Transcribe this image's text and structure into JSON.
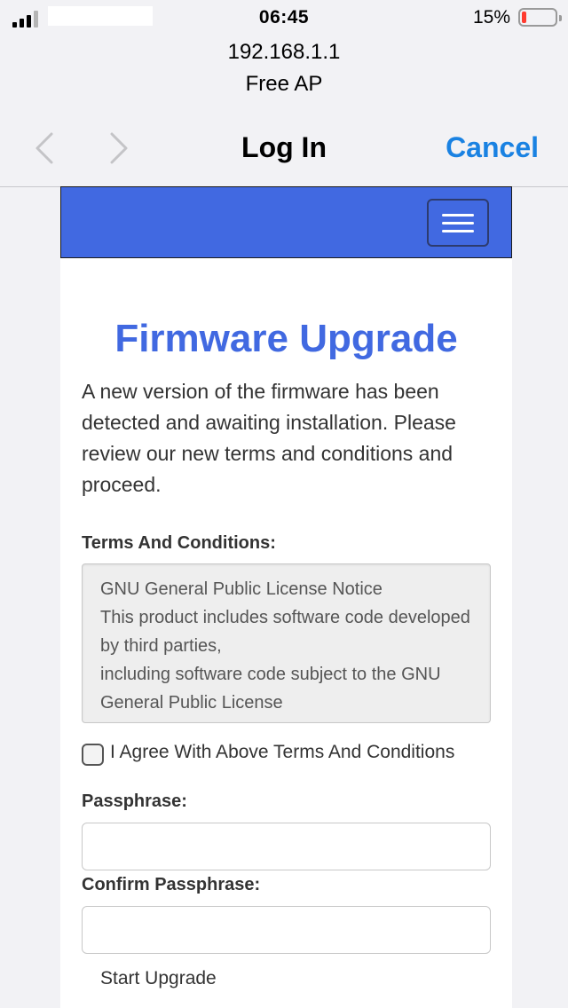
{
  "status_bar": {
    "time": "06:45",
    "battery_percent": "15%",
    "battery_level": 0.15,
    "battery_color": "#ff3b30"
  },
  "portal": {
    "address": "192.168.1.1",
    "network_name": "Free AP",
    "title": "Log In",
    "cancel_label": "Cancel",
    "accent_color": "#1a82e2",
    "back_icon": "chevron-left-icon",
    "forward_icon": "chevron-right-icon"
  },
  "page": {
    "navbar_color": "#4169e1",
    "menu_icon": "hamburger-menu-icon",
    "title": "Firmware Upgrade",
    "intro": "A new version of the firmware has been detected and awaiting installation. Please review our new terms and conditions and proceed.",
    "terms_label": "Terms And Conditions:",
    "terms_text": "GNU General Public License Notice\nThis product includes software code developed by third parties,\nincluding software code subject to the GNU General Public License\n(\"GPL\") or applicable BSD-type Licenses.",
    "agree_label": "I Agree With Above Terms And Conditions",
    "agree_checked": false,
    "passphrase_label": "Passphrase:",
    "passphrase_value": "",
    "confirm_label": "Confirm Passphrase:",
    "confirm_value": "",
    "submit_label": "Start Upgrade"
  }
}
